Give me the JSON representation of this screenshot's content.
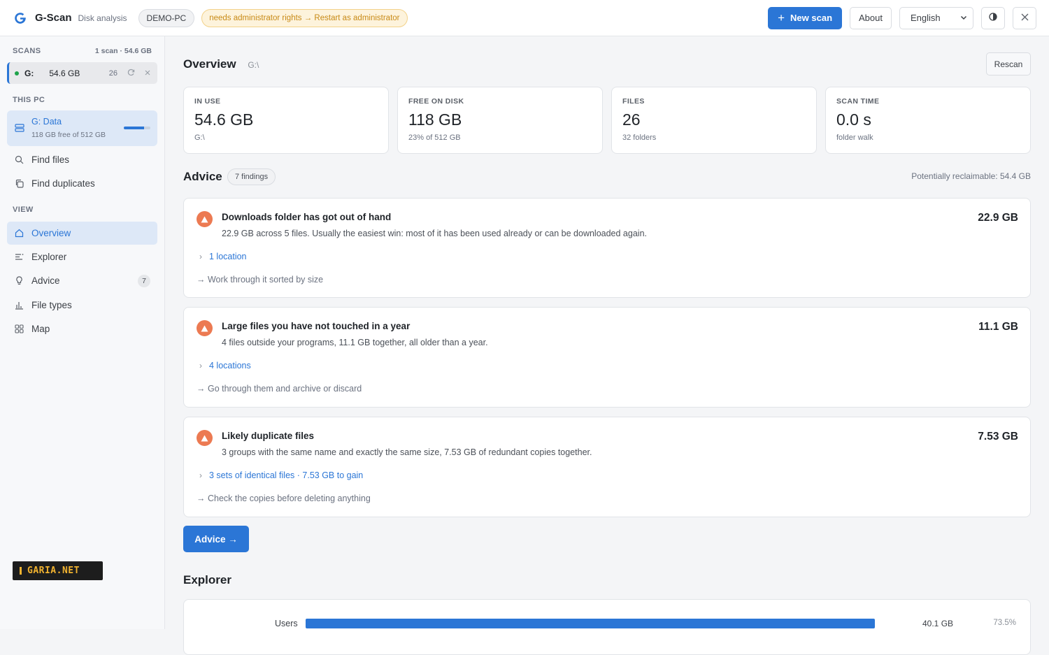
{
  "header": {
    "app_name": "G-Scan",
    "app_subtitle": "Disk analysis",
    "pc_name": "DEMO-PC",
    "admin_notice": "needs administrator rights → Restart as administrator",
    "new_scan_label": "New scan",
    "about_label": "About",
    "language": "English"
  },
  "sidebar": {
    "scans_heading": "SCANS",
    "scans_summary": "1 scan · 54.6 GB",
    "scan": {
      "drive": "G:",
      "size": "54.6 GB",
      "count": "26"
    },
    "thispc_heading": "THIS PC",
    "drive": {
      "name": "G: Data",
      "sub": "118 GB free of 512 GB",
      "used_fraction": 0.77
    },
    "tools": [
      {
        "label": "Find files"
      },
      {
        "label": "Find duplicates"
      }
    ],
    "view_heading": "VIEW",
    "view_items": [
      {
        "label": "Overview"
      },
      {
        "label": "Explorer"
      },
      {
        "label": "Advice",
        "badge": "7"
      },
      {
        "label": "File types"
      },
      {
        "label": "Map"
      }
    ],
    "brand": "GARIA.NET"
  },
  "overview": {
    "title": "Overview",
    "path": "G:\\",
    "rescan_label": "Rescan",
    "stats": [
      {
        "label": "IN USE",
        "value": "54.6 GB",
        "sub": "G:\\"
      },
      {
        "label": "FREE ON DISK",
        "value": "118 GB",
        "sub": "23% of 512 GB"
      },
      {
        "label": "FILES",
        "value": "26",
        "sub": "32 folders"
      },
      {
        "label": "SCAN TIME",
        "value": "0.0 s",
        "sub": "folder walk"
      }
    ]
  },
  "advice": {
    "title": "Advice",
    "findings": "7 findings",
    "reclaimable": "Potentially reclaimable: 54.4 GB",
    "cards": [
      {
        "title": "Downloads folder has got out of hand",
        "size": "22.9 GB",
        "description": "22.9 GB across 5 files. Usually the easiest win: most of it has been used already or can be downloaded again.",
        "link": "1 location",
        "action": "→ Work through it sorted by size"
      },
      {
        "title": "Large files you have not touched in a year",
        "size": "11.1 GB",
        "description": "4 files outside your programs, 11.1 GB together, all older than a year.",
        "link": "4 locations",
        "action": "→ Go through them and archive or discard"
      },
      {
        "title": "Likely duplicate files",
        "size": "7.53 GB",
        "description": "3 groups with the same name and exactly the same size, 7.53 GB of redundant copies together.",
        "link": "3 sets of identical files · 7.53 GB to gain",
        "action": "→ Check the copies before deleting anything"
      }
    ],
    "button_label": "Advice →"
  },
  "explorer": {
    "title": "Explorer",
    "rows": [
      {
        "name": "Users",
        "size": "40.1 GB",
        "percent": "73.5%",
        "fraction": 0.735
      }
    ]
  },
  "colors": {
    "accent": "#2b76d6",
    "warning": "#ec7a52",
    "ok": "#1ea34a"
  }
}
